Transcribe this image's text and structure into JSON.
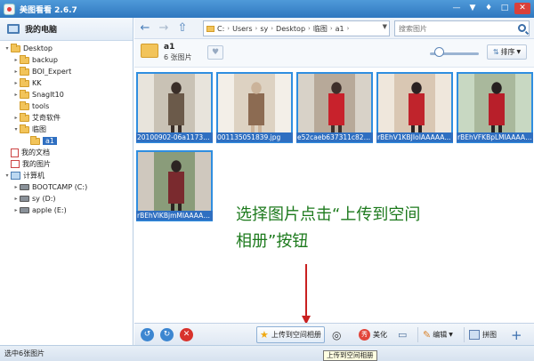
{
  "window": {
    "title": "美图看看 2.6.7",
    "controls": [
      "minimize",
      "skin",
      "maximize",
      "close"
    ]
  },
  "sidebar": {
    "header": "我的电脑",
    "tree": [
      {
        "label": "Desktop",
        "level": 0,
        "type": "folder",
        "expander": "minus"
      },
      {
        "label": "backup",
        "level": 1,
        "type": "folder",
        "expander": "plus"
      },
      {
        "label": "BOI_Expert",
        "level": 1,
        "type": "folder",
        "expander": "plus"
      },
      {
        "label": "KK",
        "level": 1,
        "type": "folder",
        "expander": "plus"
      },
      {
        "label": "SnagIt10",
        "level": 1,
        "type": "folder",
        "expander": "plus"
      },
      {
        "label": "tools",
        "level": 1,
        "type": "folder",
        "expander": "none"
      },
      {
        "label": "艾奇软件",
        "level": 1,
        "type": "folder",
        "expander": "plus"
      },
      {
        "label": "临图",
        "level": 1,
        "type": "folder",
        "expander": "minus"
      },
      {
        "label": "a1",
        "level": 2,
        "type": "folder",
        "expander": "none",
        "selected": true
      },
      {
        "label": "我的文档",
        "level": 0,
        "type": "doc",
        "expander": "none"
      },
      {
        "label": "我的图片",
        "level": 0,
        "type": "pic",
        "expander": "none"
      },
      {
        "label": "计算机",
        "level": 0,
        "type": "computer",
        "expander": "minus"
      },
      {
        "label": "BOOTCAMP (C:)",
        "level": 1,
        "type": "drive",
        "expander": "plus"
      },
      {
        "label": "sy (D:)",
        "level": 1,
        "type": "drive",
        "expander": "plus"
      },
      {
        "label": "apple (E:)",
        "level": 1,
        "type": "drive",
        "expander": "plus"
      }
    ]
  },
  "navbar": {
    "breadcrumbs": [
      "C:",
      "Users",
      "sy",
      "Desktop",
      "临图",
      "a1"
    ],
    "search_placeholder": "搜索图片"
  },
  "folder_info": {
    "name": "a1",
    "count": "6 张图片",
    "sort_label": "排序",
    "zoom_level": 0.1
  },
  "thumbnails": [
    {
      "filename": "20100902-06a11732...",
      "tag": "JPG"
    },
    {
      "filename": "001135051839.jpg",
      "tag": "JPG"
    },
    {
      "filename": "e52caeb637311c824...",
      "tag": "JPG"
    },
    {
      "filename": "rBEhV1KBJIoIAAAAA...",
      "tag": "JPG"
    },
    {
      "filename": "rBEhVFKBpLMIAAAAA...",
      "tag": "JPG"
    },
    {
      "filename": "rBEhVlKBjmMIAAAAA...",
      "tag": "JPG"
    }
  ],
  "annotation": {
    "line1": "选择图片点击“上传到空间",
    "line2": "相册”按钮"
  },
  "toolbar": {
    "upload_label": "上传到空间相册",
    "beautify_label": "美化",
    "edit_label": "编辑",
    "collage_label": "拼图",
    "tooltip": "上传到空间相册"
  },
  "status": {
    "text": "选中6张图片"
  }
}
